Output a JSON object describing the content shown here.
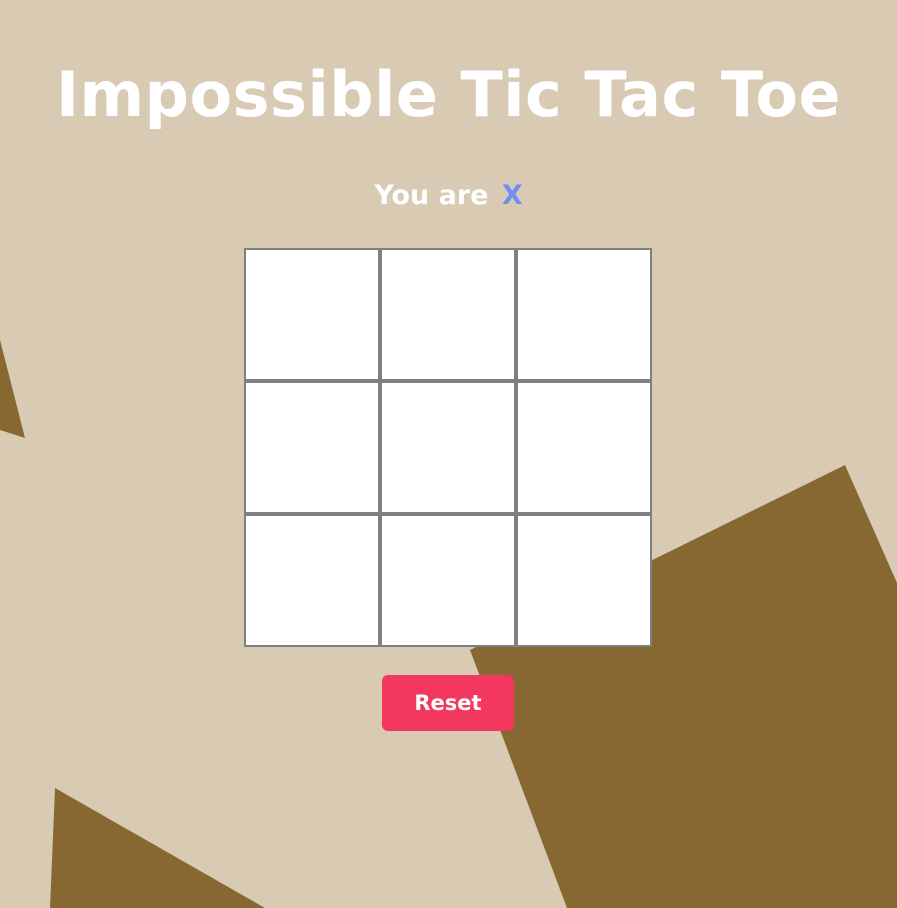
{
  "title": "Impossible Tic Tac Toe",
  "status": {
    "prefix": "You are",
    "player": "X"
  },
  "board": {
    "cells": [
      "",
      "",
      "",
      "",
      "",
      "",
      "",
      "",
      ""
    ]
  },
  "reset_label": "Reset",
  "colors": {
    "background": "#d9cab3",
    "shape": "#876832",
    "player_x": "#6f8ff2",
    "reset_button": "#f2385e",
    "cell_border": "#808080"
  }
}
